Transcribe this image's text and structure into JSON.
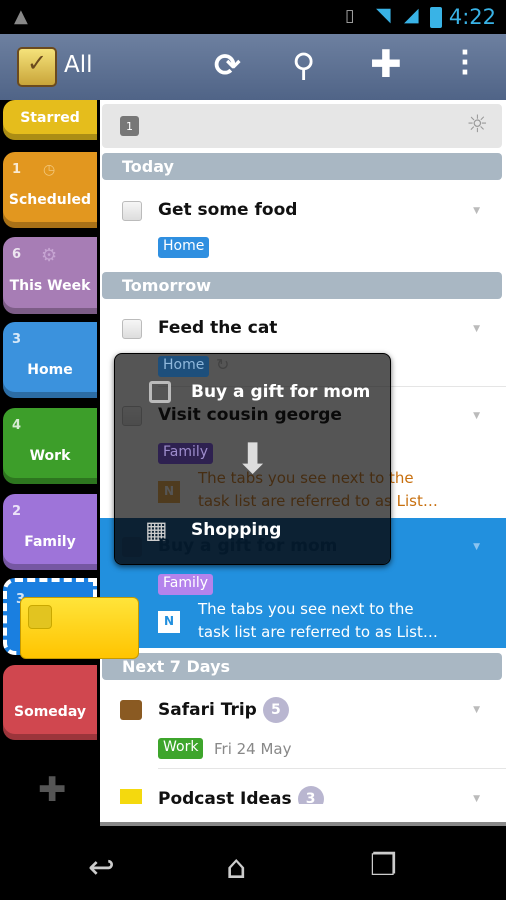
{
  "status_bar": {
    "time": "4:22"
  },
  "action_bar": {
    "title": "All",
    "icons": [
      "app-logo-icon",
      "sync-icon",
      "search-icon",
      "add-icon",
      "overflow-menu-icon"
    ]
  },
  "tabs": [
    {
      "label": "Starred",
      "count": "",
      "color": "#e5bd1c"
    },
    {
      "label": "Scheduled",
      "count": "1",
      "color": "#e2971f"
    },
    {
      "label": "This Week",
      "count": "6",
      "color": "#a77db5"
    },
    {
      "label": "Home",
      "count": "3",
      "color": "#3b92dd"
    },
    {
      "label": "Work",
      "count": "4",
      "color": "#3d9e2a"
    },
    {
      "label": "Family",
      "count": "2",
      "color": "#9e74d9"
    },
    {
      "label": "",
      "count": "3",
      "color": "#1a7fe0"
    },
    {
      "label": "Someday",
      "count": "",
      "color": "#d0474f"
    }
  ],
  "list": {
    "date_bar_day": "1",
    "sections": {
      "today": "Today",
      "tomorrow": "Tomorrow",
      "next7": "Next 7 Days"
    },
    "tasks": [
      {
        "title": "Get some food",
        "tag": "Home",
        "tag_color": "#2f8fe0"
      },
      {
        "title": "Feed the cat",
        "tag": "Home",
        "tag_color": "#2f8fe0"
      },
      {
        "title": "Visit cousin george",
        "tag": "Family",
        "tag_color": "#9e74d9",
        "note": "The tabs you see next to the",
        "note2": "task list are referred to as List…"
      },
      {
        "title": "Buy a gift for mom",
        "tag": "Family",
        "tag_color": "#b483ec",
        "note": "The tabs you see next to the",
        "note2": "task list are referred to as List…"
      },
      {
        "title": "Safari Trip",
        "badge": "5",
        "tag": "Work",
        "tag_color": "#3ea52c",
        "date": "Fri 24 May"
      },
      {
        "title": "Podcast Ideas",
        "badge": "3"
      }
    ]
  },
  "drag_overlay": {
    "task": "Buy a gift for mom",
    "target": "Shopping"
  },
  "colors": {
    "selected_row": "#2290de",
    "header": "#a9b7c3",
    "accent": "#39b3e6"
  }
}
